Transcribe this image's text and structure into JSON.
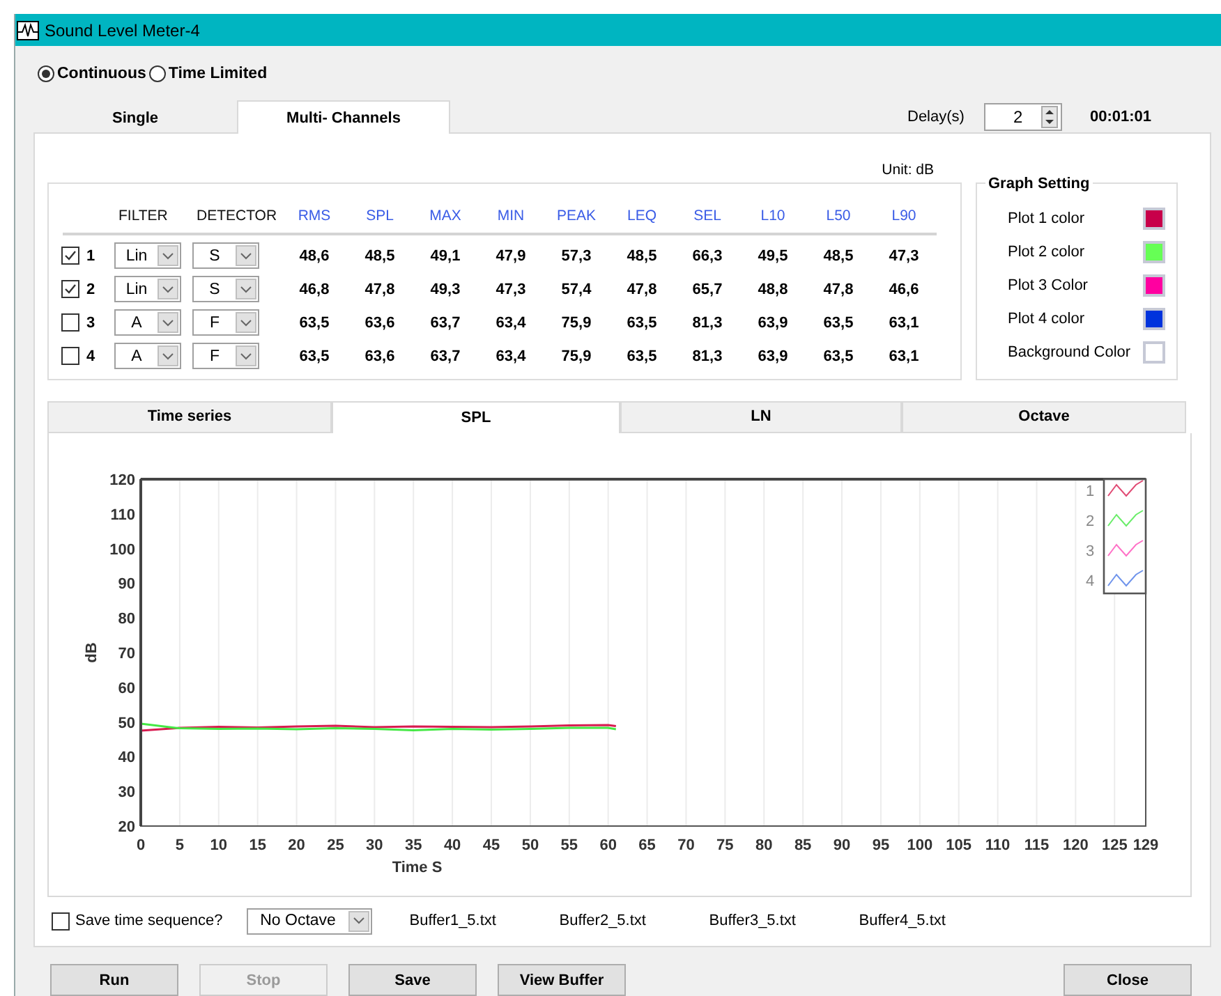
{
  "window": {
    "title": "Sound Level Meter-4"
  },
  "mode_options": [
    {
      "label": "Continuous",
      "selected": true
    },
    {
      "label": "Time Limited",
      "selected": false
    }
  ],
  "tabs": [
    {
      "label": "Single",
      "selected": false
    },
    {
      "label": "Multi- Channels",
      "selected": true
    }
  ],
  "delay": {
    "label": "Delay(s)",
    "value": "2"
  },
  "elapsed": "00:01:01",
  "unit": "Unit: dB",
  "table": {
    "columns": [
      "FILTER",
      "DETECTOR",
      "RMS",
      "SPL",
      "MAX",
      "MIN",
      "PEAK",
      "LEQ",
      "SEL",
      "L10",
      "L50",
      "L90"
    ],
    "rows": [
      {
        "checked": true,
        "number": "1",
        "filter": "Lin",
        "detector": "S",
        "values": [
          "48,6",
          "48,5",
          "49,1",
          "47,9",
          "57,3",
          "48,5",
          "66,3",
          "49,5",
          "48,5",
          "47,3"
        ]
      },
      {
        "checked": true,
        "number": "2",
        "filter": "Lin",
        "detector": "S",
        "values": [
          "46,8",
          "47,8",
          "49,3",
          "47,3",
          "57,4",
          "47,8",
          "65,7",
          "48,8",
          "47,8",
          "46,6"
        ]
      },
      {
        "checked": false,
        "number": "3",
        "filter": "A",
        "detector": "F",
        "values": [
          "63,5",
          "63,6",
          "63,7",
          "63,4",
          "75,9",
          "63,5",
          "81,3",
          "63,9",
          "63,5",
          "63,1"
        ]
      },
      {
        "checked": false,
        "number": "4",
        "filter": "A",
        "detector": "F",
        "values": [
          "63,5",
          "63,6",
          "63,7",
          "63,4",
          "75,9",
          "63,5",
          "81,3",
          "63,9",
          "63,5",
          "63,1"
        ]
      }
    ]
  },
  "graph_setting": {
    "title": "Graph Setting",
    "items": [
      {
        "label": "Plot 1 color",
        "color": "#c8004a"
      },
      {
        "label": "Plot 2 color",
        "color": "#66ff55"
      },
      {
        "label": "Plot 3 Color",
        "color": "#ff00a0"
      },
      {
        "label": "Plot 4 color",
        "color": "#0033dd"
      },
      {
        "label": "Background Color",
        "color": "#ffffff"
      }
    ]
  },
  "graph_tabs": [
    {
      "label": "Time series",
      "selected": false
    },
    {
      "label": "SPL",
      "selected": true
    },
    {
      "label": "LN",
      "selected": false
    },
    {
      "label": "Octave",
      "selected": false
    }
  ],
  "graph": {
    "chart_data": {
      "type": "line",
      "xlabel": "Time S",
      "ylabel": "dB",
      "x": [
        0,
        5,
        10,
        15,
        20,
        25,
        30,
        35,
        40,
        45,
        50,
        55,
        60,
        61
      ],
      "series": [
        {
          "name": "1",
          "color": "#d81b50",
          "values": [
            47.5,
            48.3,
            48.6,
            48.4,
            48.7,
            48.9,
            48.5,
            48.7,
            48.6,
            48.5,
            48.7,
            49.0,
            49.1,
            48.8
          ]
        },
        {
          "name": "2",
          "color": "#44e844",
          "values": [
            49.5,
            48.2,
            48.0,
            48.1,
            47.9,
            48.2,
            48.0,
            47.6,
            48.0,
            47.8,
            48.0,
            48.3,
            48.3,
            47.9
          ]
        },
        {
          "name": "3",
          "color": "#ff4cb8",
          "values": [
            null,
            null,
            null,
            null,
            null,
            null,
            null,
            null,
            null,
            null,
            null,
            null,
            null,
            null
          ]
        },
        {
          "name": "4",
          "color": "#4a78e6",
          "values": [
            null,
            null,
            null,
            null,
            null,
            null,
            null,
            null,
            null,
            null,
            null,
            null,
            null,
            null
          ]
        }
      ],
      "xlim": [
        0,
        129
      ],
      "ylim": [
        20,
        120
      ],
      "xticks": [
        0,
        5,
        10,
        15,
        20,
        25,
        30,
        35,
        40,
        45,
        50,
        55,
        60,
        65,
        70,
        75,
        80,
        85,
        90,
        95,
        100,
        105,
        110,
        115,
        120,
        125,
        129
      ],
      "yticks": [
        20,
        30,
        40,
        50,
        60,
        70,
        80,
        90,
        100,
        110,
        120
      ],
      "grid": true,
      "legend": true
    }
  },
  "save_sequence": {
    "label": "Save time sequence?",
    "checked": false
  },
  "octave_select": {
    "value": "No Octave"
  },
  "buffers": [
    "Buffer1_5.txt",
    "Buffer2_5.txt",
    "Buffer3_5.txt",
    "Buffer4_5.txt"
  ],
  "buttons": [
    {
      "label": "Run",
      "disabled": false
    },
    {
      "label": "Stop",
      "disabled": true
    },
    {
      "label": "Save",
      "disabled": false
    },
    {
      "label": "View Buffer",
      "disabled": false
    },
    {
      "label": "Close",
      "disabled": false
    }
  ]
}
